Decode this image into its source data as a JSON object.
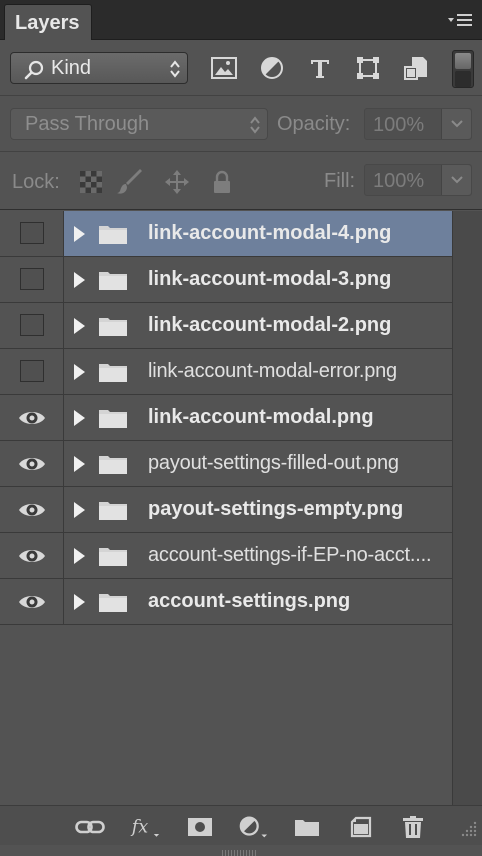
{
  "panel": {
    "title": "Layers"
  },
  "filter": {
    "kind_label": "Kind"
  },
  "blend": {
    "mode": "Pass Through",
    "opacity_label": "Opacity:",
    "opacity_value": "100%"
  },
  "lock": {
    "label": "Lock:",
    "fill_label": "Fill:",
    "fill_value": "100%"
  },
  "layers": [
    {
      "name": "link-account-modal-4.png",
      "visible": false,
      "selected": true,
      "bold": true
    },
    {
      "name": "link-account-modal-3.png",
      "visible": false,
      "selected": false,
      "bold": true
    },
    {
      "name": "link-account-modal-2.png",
      "visible": false,
      "selected": false,
      "bold": true
    },
    {
      "name": "link-account-modal-error.png",
      "visible": false,
      "selected": false,
      "bold": false
    },
    {
      "name": "link-account-modal.png",
      "visible": true,
      "selected": false,
      "bold": true
    },
    {
      "name": "payout-settings-filled-out.png",
      "visible": true,
      "selected": false,
      "bold": false
    },
    {
      "name": "payout-settings-empty.png",
      "visible": true,
      "selected": false,
      "bold": true
    },
    {
      "name": "account-settings-if-EP-no-acct....",
      "visible": true,
      "selected": false,
      "bold": false
    },
    {
      "name": "account-settings.png",
      "visible": true,
      "selected": false,
      "bold": true
    }
  ],
  "colors": {
    "panel_bg": "#535353",
    "selected_row": "#6e809c",
    "text": "#e9e9e9"
  }
}
